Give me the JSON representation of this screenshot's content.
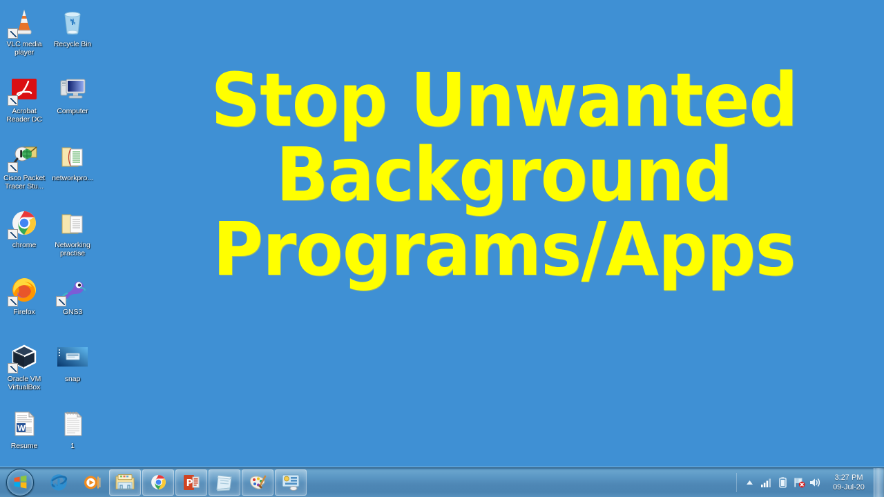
{
  "desktop": {
    "background_color": "#3f90d4",
    "icons": [
      {
        "label": "VLC media player",
        "icon": "vlc-cone-icon",
        "shortcut": true
      },
      {
        "label": "Recycle Bin",
        "icon": "recycle-bin-icon",
        "shortcut": false
      },
      {
        "label": "Acrobat Reader DC",
        "icon": "acrobat-reader-icon",
        "shortcut": true
      },
      {
        "label": "Computer",
        "icon": "computer-monitor-icon",
        "shortcut": false
      },
      {
        "label": "Cisco Packet Tracer Stu...",
        "icon": "cisco-packet-tracer-icon",
        "shortcut": true
      },
      {
        "label": "networkpro...",
        "icon": "open-folder-icon",
        "shortcut": false
      },
      {
        "label": "chrome",
        "icon": "google-chrome-icon",
        "shortcut": true
      },
      {
        "label": "Networking practise",
        "icon": "open-folder-icon",
        "shortcut": false
      },
      {
        "label": "Firefox",
        "icon": "firefox-icon",
        "shortcut": true
      },
      {
        "label": "GNS3",
        "icon": "gns3-chameleon-icon",
        "shortcut": true
      },
      {
        "label": "Oracle VM VirtualBox",
        "icon": "virtualbox-icon",
        "shortcut": true
      },
      {
        "label": "snap",
        "icon": "image-thumbnail-icon",
        "shortcut": false
      },
      {
        "label": "Resume",
        "icon": "word-document-icon",
        "shortcut": false
      },
      {
        "label": "1",
        "icon": "notepad-document-icon",
        "shortcut": false
      }
    ]
  },
  "overlay_title": {
    "color": "#ffff00",
    "lines": [
      "Stop Unwanted",
      "Background",
      "Programs/Apps"
    ]
  },
  "taskbar": {
    "start_button": {
      "label": "Start",
      "icon": "windows-start-orb-icon"
    },
    "pinned": [
      {
        "name": "Internet Explorer",
        "icon": "internet-explorer-icon",
        "framed": false
      },
      {
        "name": "Windows Media Player",
        "icon": "media-player-icon",
        "framed": false
      },
      {
        "name": "Windows Explorer",
        "icon": "file-explorer-icon",
        "framed": true
      },
      {
        "name": "Google Chrome",
        "icon": "google-chrome-icon",
        "framed": true
      },
      {
        "name": "Microsoft PowerPoint",
        "icon": "powerpoint-icon",
        "framed": true
      },
      {
        "name": "Sticky Notes",
        "icon": "sticky-notes-icon",
        "framed": true
      },
      {
        "name": "Paint",
        "icon": "paint-palette-icon",
        "framed": true
      },
      {
        "name": "Control Panel",
        "icon": "control-panel-icon",
        "framed": true
      }
    ],
    "tray": {
      "icons": [
        {
          "name": "show-hidden-icons-arrow-icon"
        },
        {
          "name": "network-signal-icon"
        },
        {
          "name": "battery-icon"
        },
        {
          "name": "action-center-flag-alert-icon"
        },
        {
          "name": "volume-speaker-icon"
        }
      ],
      "clock": {
        "time": "3:27 PM",
        "date": "09-Jul-20"
      },
      "show_desktop_label": "Show desktop"
    }
  }
}
